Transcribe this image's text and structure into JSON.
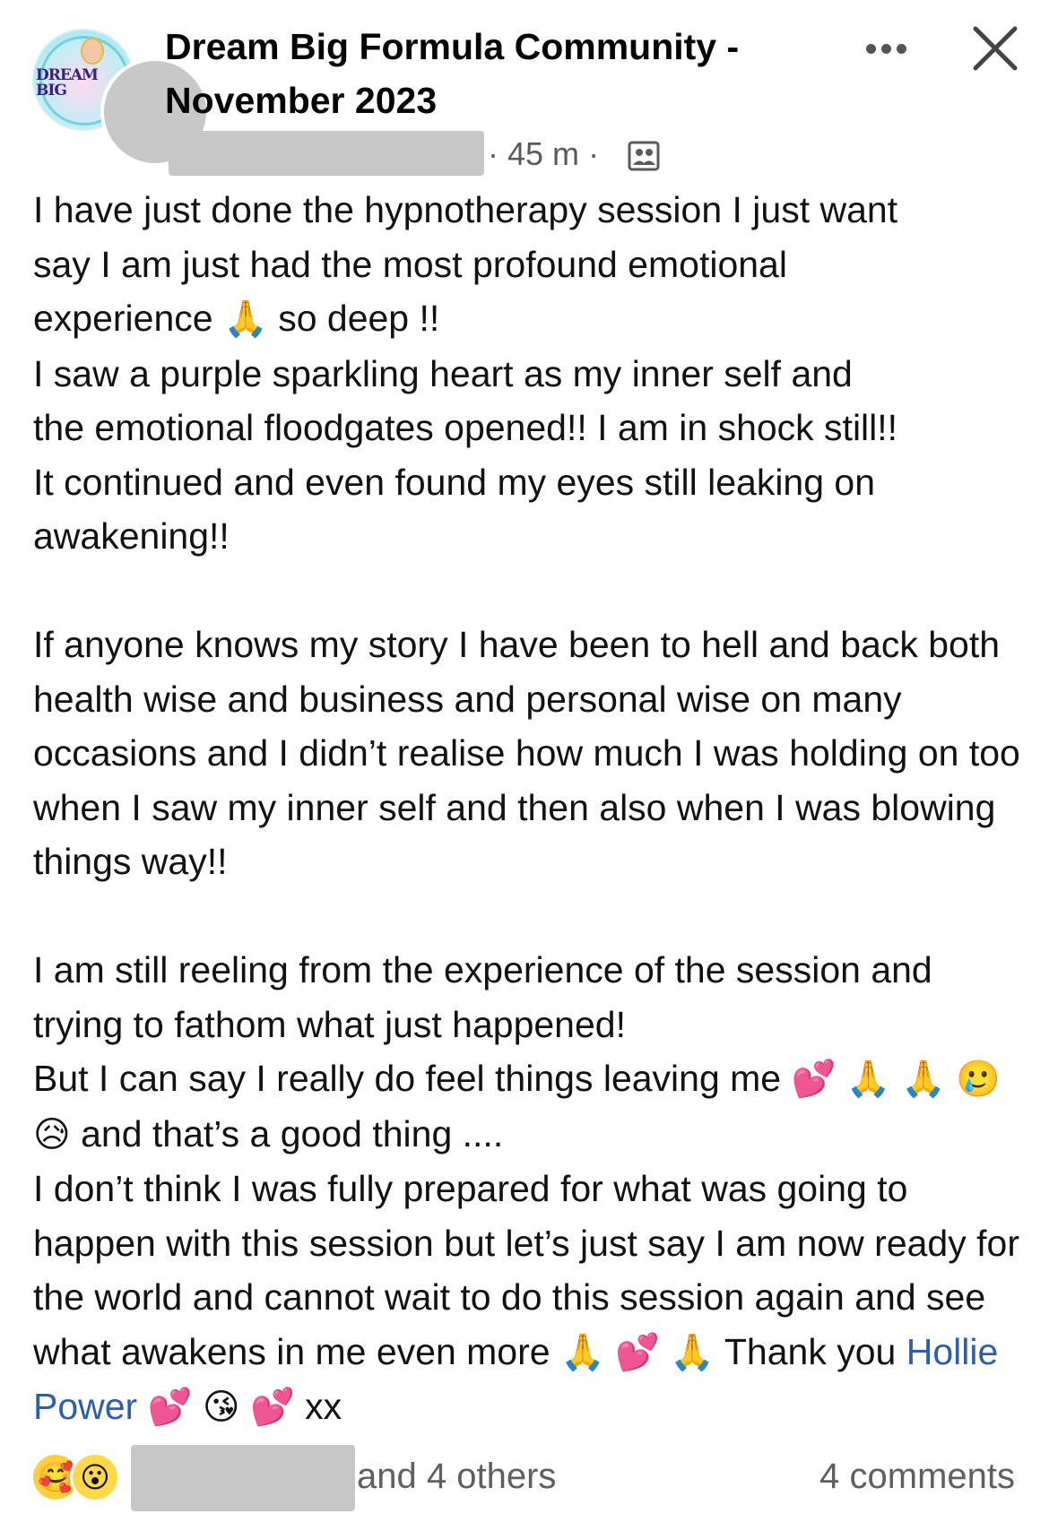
{
  "post": {
    "group_name": "Dream Big Formula Community - November 2023",
    "group_avatar_text": "DREAM BIG",
    "timestamp": "45 m",
    "separator": "·",
    "body": {
      "line1": "I have just done the hypnotherapy session I just want",
      "line2": "say I am just had the most profound emotional",
      "line3a": "experience",
      "line3b": "so deep !!",
      "line4": "I saw a purple sparkling heart as my inner self  and",
      "line5": "the emotional floodgates opened!! I am in shock still!!",
      "line6": "It continued and even found my eyes still leaking on",
      "line7": "awakening!!",
      "para2": "If anyone knows my story I have been to hell and back both health wise and business and personal wise on many occasions and I didn’t realise how much I was holding on too  when I saw my inner self and then also when I was blowing things way!!",
      "para3a": "I am still reeling from the experience of the session and trying to fathom what just happened!",
      "para3b": "But I can say I really do feel things leaving me",
      "para3c": "and that’s a good thing ....",
      "para4": "I don’t think I was fully prepared for what was going to happen with this session but let’s just say I am now ready for the world and cannot wait to do this session again and see what awakens in me even more",
      "thanks": "Thank you",
      "mention": "Hollie Power",
      "signoff": "xx"
    },
    "emoji": {
      "pray": "🙏",
      "hearts": "💕",
      "crying": "🥲",
      "sad_relieved": "😥",
      "kiss": "😘"
    }
  },
  "footer": {
    "reaction_icons": [
      "care-reaction-icon",
      "wow-reaction-icon"
    ],
    "reaction_glyphs": [
      "🥰",
      "😮"
    ],
    "reactions_text": "and 4 others",
    "comments_text": "4 comments"
  },
  "colors": {
    "mention": "#2d5fa8",
    "meta_text": "#5a5a5a",
    "redaction": "#c7c7c7"
  }
}
